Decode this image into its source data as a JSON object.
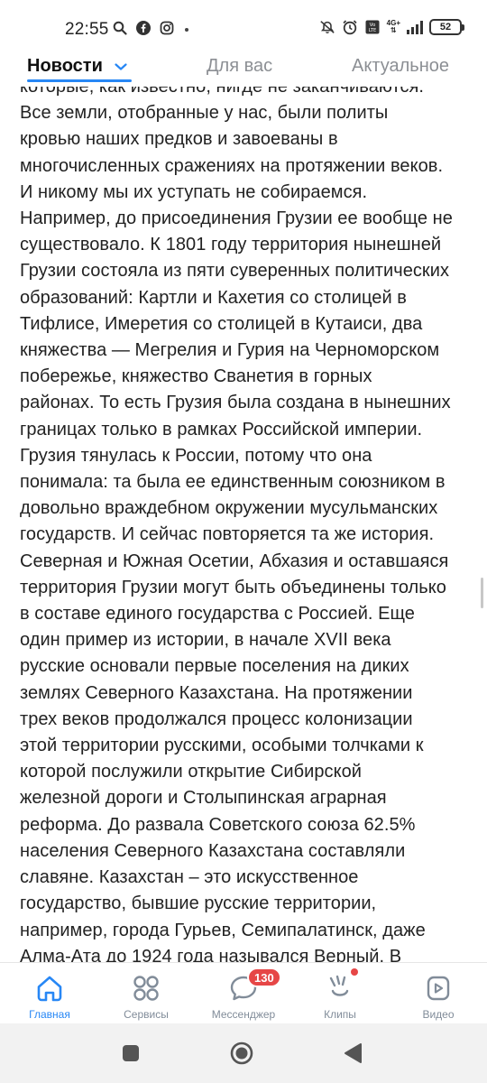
{
  "status_bar": {
    "time": "22:55",
    "battery": "52",
    "network": "4G+"
  },
  "tabs": [
    {
      "label": "Новости"
    },
    {
      "label": "Для вас"
    },
    {
      "label": "Актуальное"
    }
  ],
  "article": {
    "text": "которые, как известно, нигде не заканчиваются.\nВсе земли, отобранные у нас, были политы\nкровью наших предков и завоеваны в\nмногочисленных сражениях на протяжении веков.\nИ никому мы их уступать не собираемся.\nНапример, до присоединения Грузии ее вообще не\nсуществовало. К 1801 году территория нынешней\nГрузии состояла из пяти суверенных политических\nобразований: Картли и Кахетия со столицей в\nТифлисе, Имеретия со столицей в Кутаиси, два\nкняжества — Мегрелия и Гурия на Черноморском\nпобережье, княжество Сванетия в горных\nрайонах. То есть Грузия была создана в нынешних\nграницах только в рамках Российской империи.\nГрузия тянулась к России, потому что она\nпонимала: та была ее единственным союзником в\nдовольно враждебном окружении мусульманских\nгосударств. И сейчас повторяется та же история.\nСеверная и Южная Осетии, Абхазия и оставшаяся\nтерритория Грузии могут быть объединены только\nв составе единого государства с Россией. Еще\nодин пример из истории, в начале XVII века\nрусские основали первые поселения на диких\nземлях Северного Казахстана. На протяжении\nтрех веков продолжался процесс колонизации\nэтой территории русскими, особыми толчками к\nкоторой послужили открытие Сибирской\nжелезной дороги и Столыпинская аграрная\nреформа. До развала Советского союза 62.5%\nнаселения Северного Казахстана составляли\nславяне. Казахстан – это искусственное\nгосударство, бывшие русские территории,\nнапример, города Гурьев, Семипалатинск, даже\nАлма-Ата до 1924 года назывался Верный. В"
  },
  "bottom_nav": {
    "items": [
      {
        "label": "Главная",
        "icon": "home-icon"
      },
      {
        "label": "Сервисы",
        "icon": "services-icon"
      },
      {
        "label": "Мессенджер",
        "icon": "messenger-icon",
        "badge": "130"
      },
      {
        "label": "Клипы",
        "icon": "clips-icon"
      },
      {
        "label": "Видео",
        "icon": "video-icon"
      }
    ]
  },
  "colors": {
    "accent": "#2787f5",
    "badge": "#e64646",
    "muted": "#818c99"
  }
}
